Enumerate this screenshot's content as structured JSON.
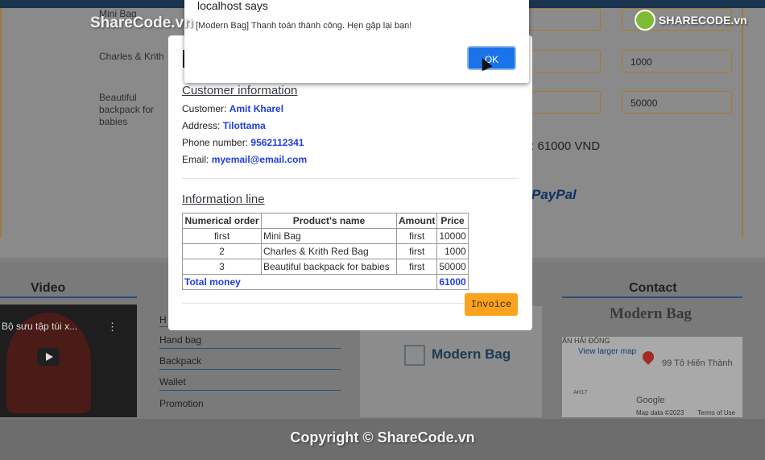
{
  "watermark": {
    "left": "ShareCode.vn",
    "right": "SHARECODE.vn",
    "copyright": "Copyright © ShareCode.vn"
  },
  "background": {
    "cart_items": [
      {
        "name": "Mini Bag",
        "qty": "",
        "price": ""
      },
      {
        "name": "Charles & Krith",
        "qty": "",
        "price": "1000"
      },
      {
        "name": "Beautiful backpack for babies",
        "qty": "",
        "price": "50000"
      }
    ],
    "total_text": "t: 61000 VND",
    "paypal": "PayPal",
    "footer": {
      "video_title": "Video",
      "video_caption": "Bộ sưu tập túi x...",
      "links": [
        "Hand bag",
        "Backpack",
        "Wallet",
        "Promotion"
      ],
      "contact_title": "Contact",
      "contact_brand": "Modern Bag",
      "logo_text": "Modern Bag",
      "map": {
        "view_larger": "View larger map",
        "address": "99 Tô Hiến Thành",
        "district": "ẤN HẢI ĐÔNG",
        "google": "Google",
        "map_data": "Map data ©2023",
        "terms": "Terms of Use",
        "road": "AH17"
      }
    }
  },
  "alert": {
    "title": "localhost says",
    "message": "[Modern Bag] Thanh toán thành công. Hẹn gặp lại bạn!",
    "ok": "OK"
  },
  "modal": {
    "customer_section": "Customer information",
    "customer_label": "Customer:",
    "customer_value": "Amit Kharel",
    "address_label": "Address:",
    "address_value": "Tilottama",
    "phone_label": "Phone number:",
    "phone_value": "9562112341",
    "email_label": "Email:",
    "email_value": "myemail@email.com",
    "line_section": "Information line",
    "table": {
      "headers": [
        "Numerical order",
        "Product's name",
        "Amount",
        "Price"
      ],
      "rows": [
        [
          "first",
          "Mini Bag",
          "first",
          "10000"
        ],
        [
          "2",
          "Charles & Krith Red Bag",
          "first",
          "1000"
        ],
        [
          "3",
          "Beautiful backpack for babies",
          "first",
          "50000"
        ]
      ],
      "total_label": "Total money",
      "total_value": "61000"
    },
    "invoice_button": "Invoice"
  }
}
